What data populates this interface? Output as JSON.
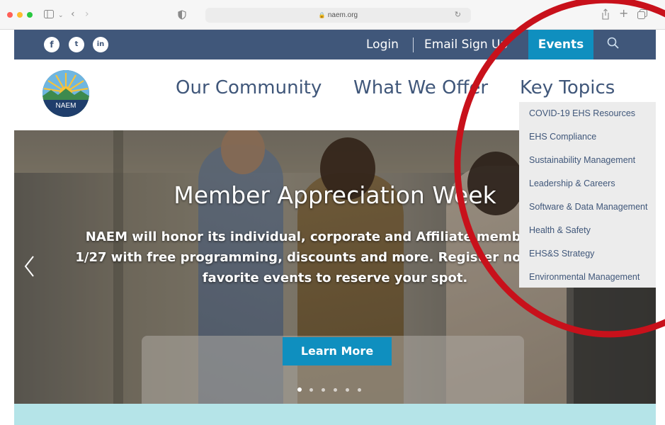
{
  "browser": {
    "url": "naem.org"
  },
  "social": [
    "f",
    "t",
    "in"
  ],
  "topbar": {
    "login": "Login",
    "email_signup": "Email Sign Up",
    "events": "Events"
  },
  "logo": {
    "text": "NAEM"
  },
  "nav": [
    {
      "label": "Our Community"
    },
    {
      "label": "What We Offer"
    },
    {
      "label": "Key Topics"
    }
  ],
  "dropdown": [
    "COVID-19 EHS Resources",
    "EHS Compliance",
    "Sustainability Management",
    "Leadership & Careers",
    "Software & Data Management",
    "Health & Safety",
    "EHS&S Strategy",
    "Environmental Management"
  ],
  "hero": {
    "title": "Member Appreciation Week",
    "text": "NAEM will honor its individual, corporate and Affiliate members 1/23-1/27 with free programming, discounts and more. Register now for your favorite events to reserve your spot.",
    "button": "Learn More",
    "slide_count": 6,
    "active_slide": 1
  },
  "colors": {
    "navy": "#40577a",
    "accent": "#0f8fbf",
    "annotation": "#c8111b"
  }
}
